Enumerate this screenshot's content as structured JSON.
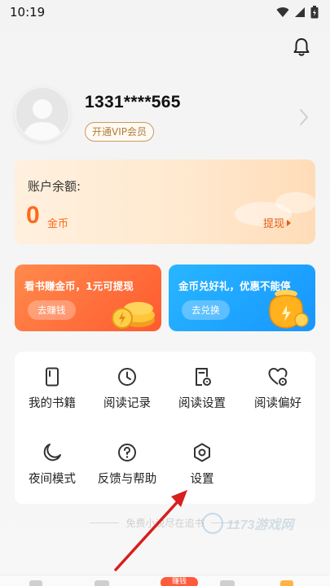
{
  "status_bar": {
    "time": "10:19"
  },
  "profile": {
    "phone": "1331****565",
    "vip_label": "开通VIP会员"
  },
  "balance": {
    "label": "账户余额:",
    "value": "0",
    "unit": "金币",
    "withdraw_label": "提现"
  },
  "promos": [
    {
      "title": "看书赚金币，1元可提现",
      "button": "去赚钱"
    },
    {
      "title": "金币兑好礼，优惠不能停",
      "button": "去兑换"
    }
  ],
  "menu": [
    {
      "label": "我的书籍",
      "icon": "book-icon"
    },
    {
      "label": "阅读记录",
      "icon": "clock-icon"
    },
    {
      "label": "阅读设置",
      "icon": "reading-settings-icon"
    },
    {
      "label": "阅读偏好",
      "icon": "heart-icon"
    },
    {
      "label": "夜间模式",
      "icon": "moon-icon"
    },
    {
      "label": "反馈与帮助",
      "icon": "help-icon"
    },
    {
      "label": "设置",
      "icon": "hexagon-settings-icon"
    }
  ],
  "footer": {
    "text": "免费小说尽在追书"
  },
  "watermark": {
    "text": "1173游戏网"
  },
  "tabbar": {
    "earn_badge": "赚钱"
  },
  "colors": {
    "accent_orange": "#ff6a1a",
    "promo_orange": "#ff6a3c",
    "promo_blue": "#1fa6ff",
    "vip_gold": "#b27c3c"
  }
}
